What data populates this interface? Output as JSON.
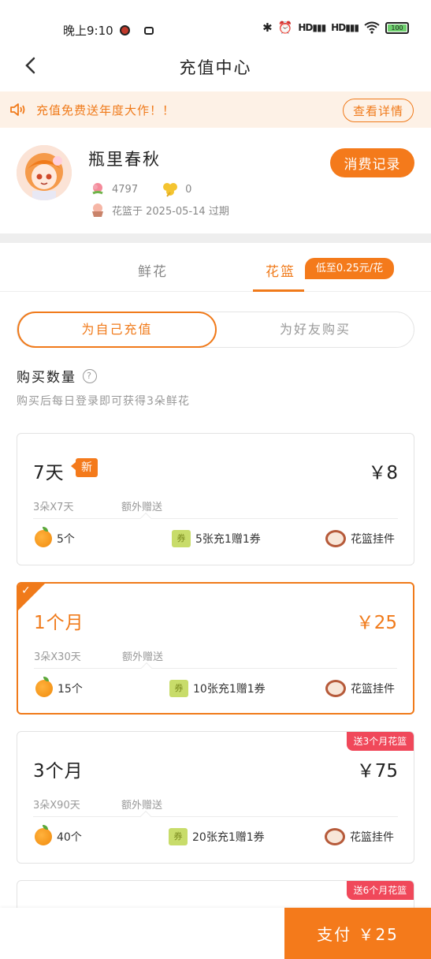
{
  "status_bar": {
    "time": "晚上9:10",
    "hd1": "HD",
    "hd2": "HD",
    "battery": "100"
  },
  "nav": {
    "title": "充值中心"
  },
  "notice": {
    "text": "充值免费送年度大作！！",
    "detail_label": "查看详情"
  },
  "profile": {
    "username": "瓶里春秋",
    "flowers_count": "4797",
    "clover_count": "0",
    "basket_expiry": "花篮于 2025-05-14 过期",
    "records_label": "消费记录"
  },
  "tabs": {
    "flowers": "鲜花",
    "basket": "花篮",
    "badge": "低至0.25元/花"
  },
  "segment": {
    "self": "为自己充值",
    "friend": "为好友购买"
  },
  "quantity": {
    "label": "购买数量",
    "help": "?",
    "subtitle": "购买后每日登录即可获得3朵鲜花"
  },
  "plans": [
    {
      "name": "7天",
      "new_badge": "新",
      "price": "￥8",
      "per": "3朵X7天",
      "extra_label": "额外赠送",
      "oranges": "5个",
      "coupon_icon": "券",
      "coupon": "5张充1赠1券",
      "pendant": "花篮挂件"
    },
    {
      "name": "1个月",
      "price": "￥25",
      "per": "3朵X30天",
      "extra_label": "额外赠送",
      "oranges": "15个",
      "coupon_icon": "券",
      "coupon": "10张充1赠1券",
      "pendant": "花篮挂件",
      "selected_mark": "✓"
    },
    {
      "name": "3个月",
      "price": "￥75",
      "per": "3朵X90天",
      "extra_label": "额外赠送",
      "oranges": "40个",
      "coupon_icon": "券",
      "coupon": "20张充1赠1券",
      "pendant": "花篮挂件",
      "gift_tag": "送3个月花篮"
    },
    {
      "gift_tag": "送6个月花篮"
    }
  ],
  "footer": {
    "pay_label": "支付 ￥25"
  },
  "colors": {
    "accent": "#f07a1a",
    "notice_bg": "#fdf1e6",
    "gift_tag": "#f0485a"
  }
}
